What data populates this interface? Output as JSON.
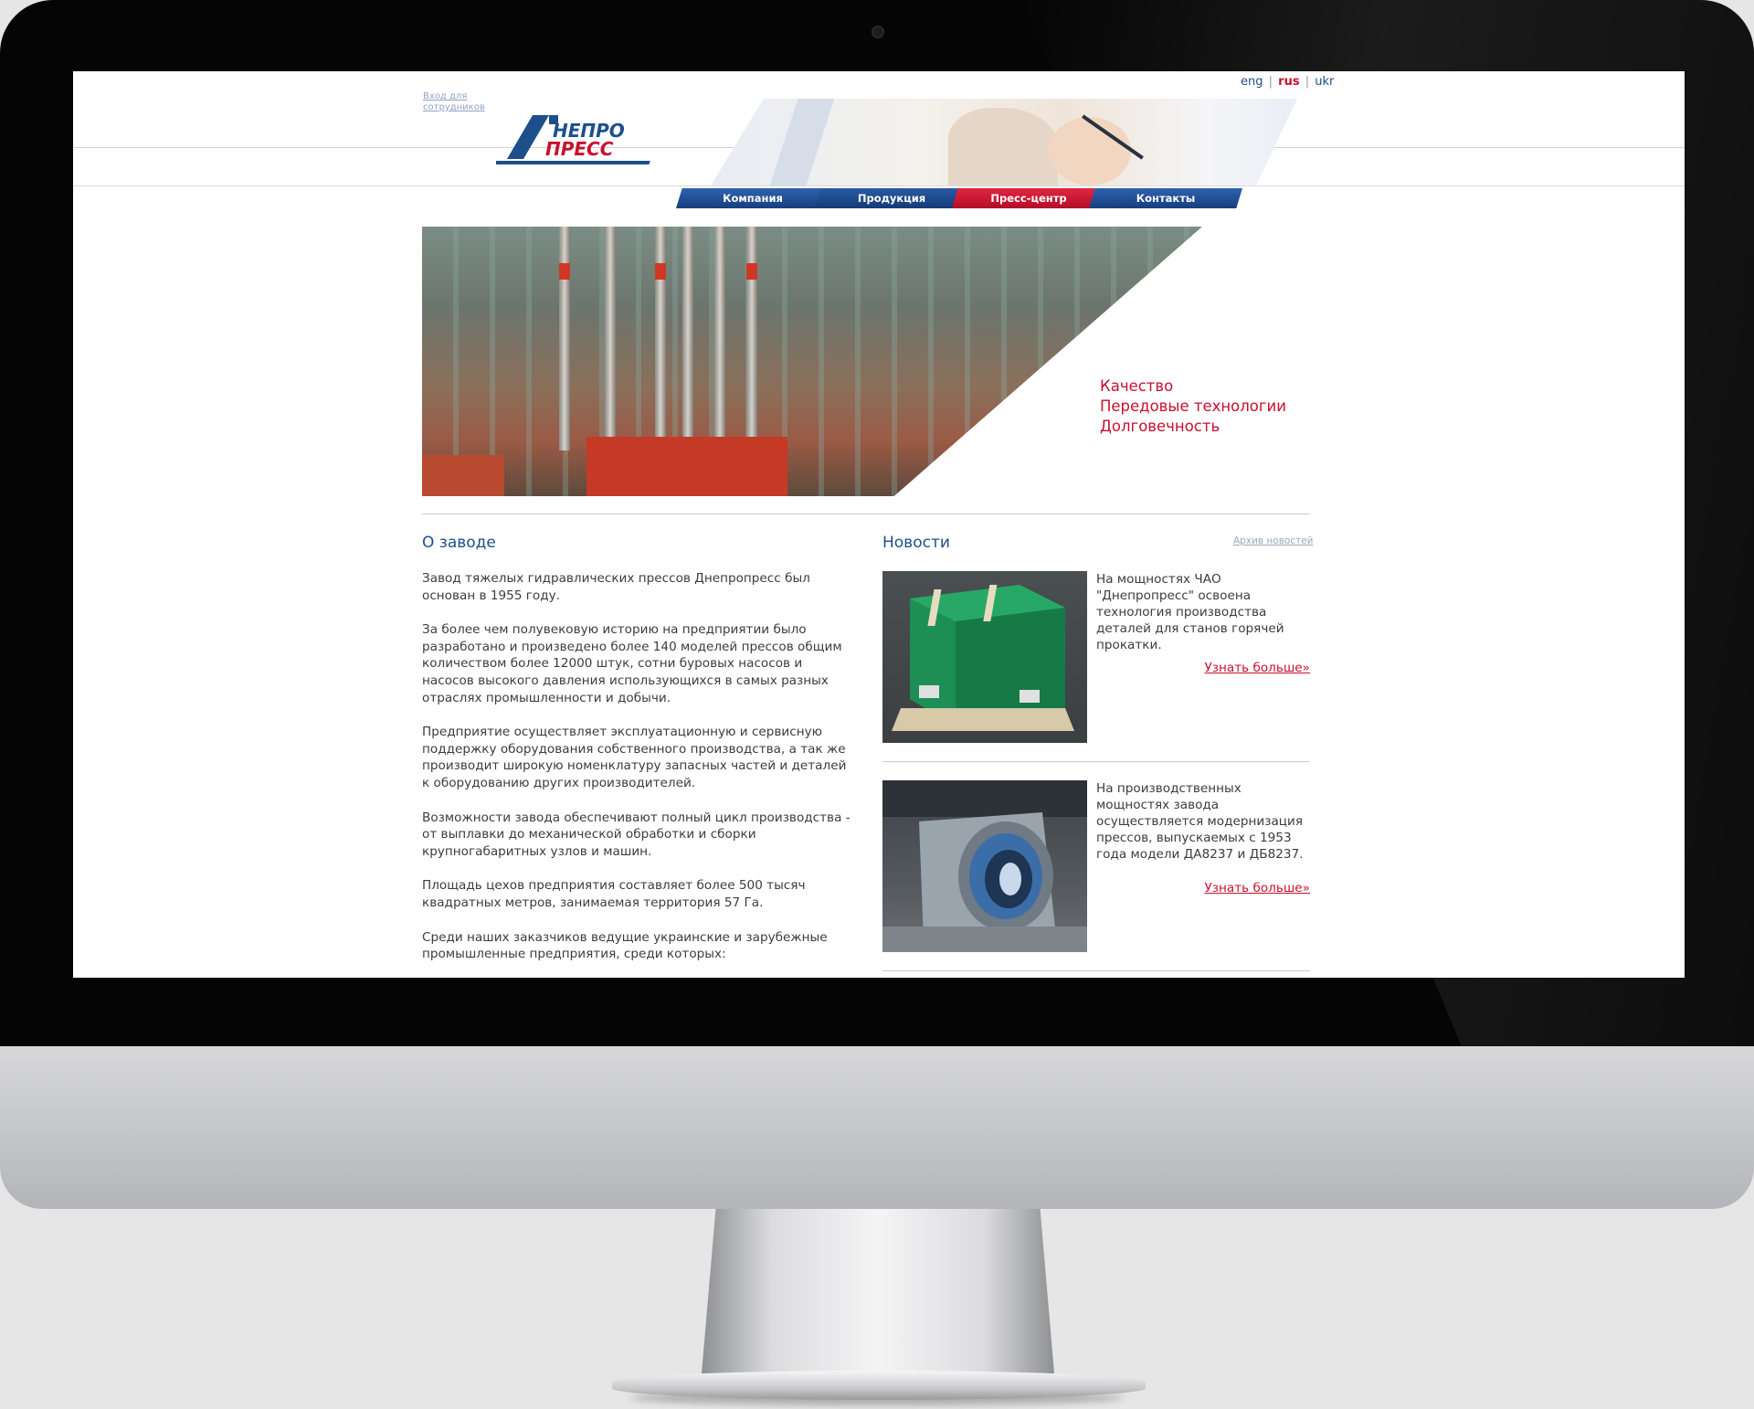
{
  "languages": {
    "eng": "eng",
    "rus": "rus",
    "ukr": "ukr",
    "separator": "|"
  },
  "header": {
    "staff_login": "Вход для сотрудников",
    "logo_alt": "Днепропресс"
  },
  "nav": {
    "items": [
      {
        "label": "Компания"
      },
      {
        "label": "Продукция"
      },
      {
        "label": "Пресс-центр",
        "active": true
      },
      {
        "label": "Контакты"
      }
    ]
  },
  "hero": {
    "taglines": [
      "Качество",
      "Передовые технологии",
      "Долговечность"
    ]
  },
  "about": {
    "title": "О заводе",
    "paragraphs": [
      "Завод тяжелых гидравлических прессов Днепропресс был основан в 1955 году.",
      "За более чем полувековую историю на предприятии было разработано и произведено более 140 моделей прессов общим количеством более 12000 штук, сотни буровых насосов и насосов высокого давления использующихся в самых разных отраслях промышленности и добычи.",
      "Предприятие осуществляет эксплуатационную и сервисную поддержку оборудования собственного производства, а так же производит широкую номенклатуру запасных частей и деталей к оборудованию других производителей.",
      "Возможности завода обеспечивают полный цикл производства - от выплавки до механической обработки и сборки крупногабаритных узлов и машин.",
      "Площадь цехов предприятия составляет более 500 тысяч квадратных метров, занимаемая территория 57 Га.",
      "Среди наших заказчиков ведущие украинские и зарубежные промышленные предприятия, среди которых:"
    ]
  },
  "news": {
    "title": "Новости",
    "archive_label": "Архив новостей",
    "items": [
      {
        "text": " На мощностях ЧАО \"Днепропресс\" освоена технология производства деталей для станов горячей прокатки.",
        "more": "Узнать больше»"
      },
      {
        "text": "На производственных мощностях завода осуществляется модернизация прессов, выпускаемых с 1953 года модели ДА8237 и ДБ8237.",
        "more": "Узнать больше»"
      }
    ]
  },
  "colors": {
    "brand_blue": "#1d4f8c",
    "brand_red": "#c8102e"
  }
}
